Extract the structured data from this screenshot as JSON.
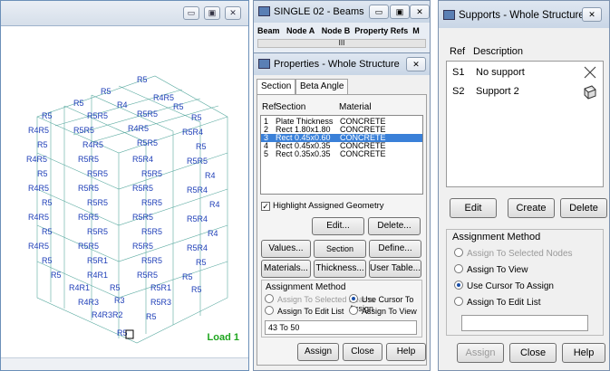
{
  "viewport": {
    "load_label": "Load 1",
    "win_buttons": [
      "▭",
      "▣",
      "✕"
    ]
  },
  "beams_window": {
    "title": "SINGLE 02 - Beams",
    "columns": [
      "Beam",
      "Node A",
      "Node B",
      "Property Refs",
      "M"
    ],
    "scroll_text": "III"
  },
  "properties_window": {
    "title": "Properties - Whole Structure",
    "close": "✕",
    "tabs": [
      "Section",
      "Beta Angle"
    ],
    "headers": [
      "Ref",
      "Section",
      "Material"
    ],
    "rows": [
      {
        "ref": "1",
        "section": "Plate Thickness",
        "material": "CONCRETE"
      },
      {
        "ref": "2",
        "section": "Rect 1.80x1.80",
        "material": "CONCRETE"
      },
      {
        "ref": "3",
        "section": "Rect 0.45x0.60",
        "material": "CONCRETE"
      },
      {
        "ref": "4",
        "section": "Rect 0.45x0.35",
        "material": "CONCRETE"
      },
      {
        "ref": "5",
        "section": "Rect 0.35x0.35",
        "material": "CONCRETE"
      }
    ],
    "highlight_label": "Highlight Assigned Geometry",
    "buttons": {
      "edit": "Edit...",
      "delete": "Delete...",
      "values": "Values...",
      "section_db": "Section Database",
      "define": "Define...",
      "materials": "Materials...",
      "thickness": "Thickness...",
      "user_table": "User Table..."
    },
    "assignment": {
      "title": "Assignment Method",
      "opt1": "Assign To Selected Beams",
      "opt2": "Use Cursor To Assign",
      "opt3": "Assign To Edit List",
      "opt4": "Assign To View",
      "edit_list": "43 To 50"
    },
    "footer": {
      "assign": "Assign",
      "close": "Close",
      "help": "Help"
    }
  },
  "supports_window": {
    "title": "Supports - Whole Structure",
    "close": "✕",
    "headers": [
      "Ref",
      "Description"
    ],
    "rows": [
      {
        "ref": "S1",
        "desc": "No support"
      },
      {
        "ref": "S2",
        "desc": "Support 2"
      }
    ],
    "buttons": {
      "edit": "Edit",
      "create": "Create",
      "delete": "Delete"
    },
    "assignment": {
      "title": "Assignment Method",
      "opt1": "Assign To Selected Nodes",
      "opt2": "Assign To View",
      "opt3": "Use Cursor To Assign",
      "opt4": "Assign To Edit List"
    },
    "footer": {
      "assign": "Assign",
      "close": "Close",
      "help": "Help"
    }
  }
}
